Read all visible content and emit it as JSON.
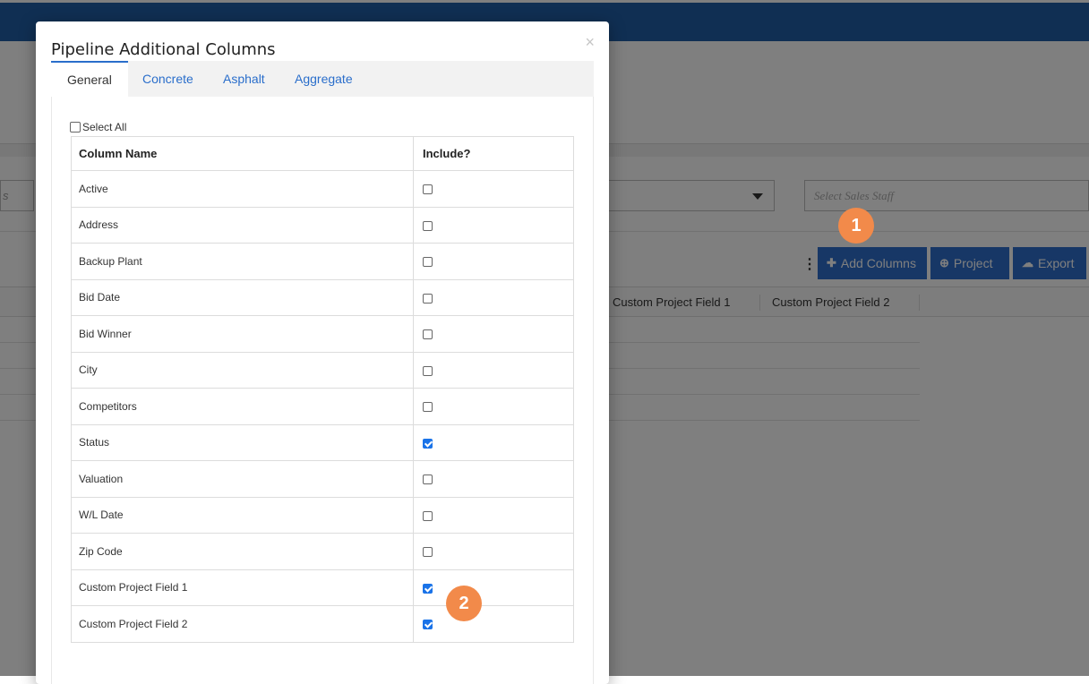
{
  "background": {
    "topbar_color": "#205fa6",
    "left_select_fragment": "s",
    "sales_staff_placeholder": "Select Sales Staff",
    "toolbar": {
      "add_columns_label": "Add Columns",
      "project_label": "Project",
      "export_label": "Export"
    },
    "grid_headers": [
      "Custom Project Field 1",
      "Custom Project Field 2"
    ]
  },
  "modal": {
    "title": "Pipeline Additional Columns",
    "close_symbol": "×",
    "tabs": [
      {
        "label": "General",
        "active": true
      },
      {
        "label": "Concrete",
        "active": false
      },
      {
        "label": "Asphalt",
        "active": false
      },
      {
        "label": "Aggregate",
        "active": false
      }
    ],
    "select_all_label": "Select All",
    "table": {
      "headers": {
        "name": "Column Name",
        "include": "Include?"
      },
      "rows": [
        {
          "name": "Active",
          "checked": false
        },
        {
          "name": "Address",
          "checked": false
        },
        {
          "name": "Backup Plant",
          "checked": false
        },
        {
          "name": "Bid Date",
          "checked": false
        },
        {
          "name": "Bid Winner",
          "checked": false
        },
        {
          "name": "City",
          "checked": false
        },
        {
          "name": "Competitors",
          "checked": false
        },
        {
          "name": "Status",
          "checked": true
        },
        {
          "name": "Valuation",
          "checked": false
        },
        {
          "name": "W/L Date",
          "checked": false
        },
        {
          "name": "Zip Code",
          "checked": false
        },
        {
          "name": "Custom Project Field 1",
          "checked": true
        },
        {
          "name": "Custom Project Field 2",
          "checked": true
        }
      ]
    }
  },
  "badges": {
    "one": "1",
    "two": "2"
  },
  "colors": {
    "accent": "#2f6fcc",
    "badge": "#f28a4a",
    "checkbox_checked": "#1a73e8"
  }
}
